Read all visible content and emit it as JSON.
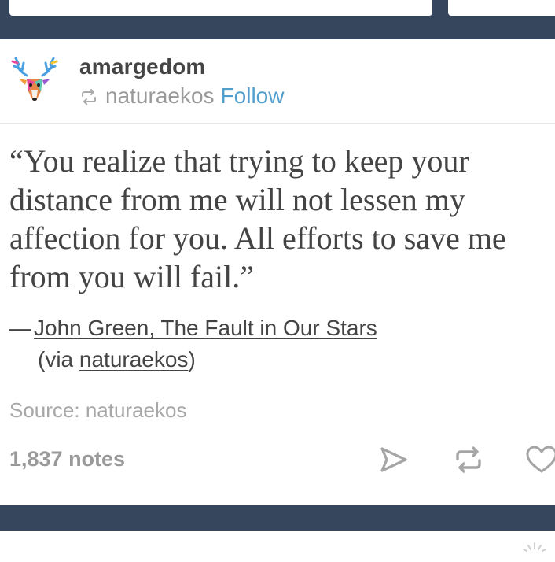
{
  "post": {
    "username": "amargedom",
    "reblogged_from": "naturaekos",
    "follow_label": "Follow",
    "quote": "“You realize that trying to keep your distance from me will not lessen my affection for you. All efforts to save me from you will fail.”",
    "attribution": {
      "dash": "—",
      "author_link": "John Green, The Fault in Our Stars",
      "via_prefix": "(via ",
      "via_link": "naturaekos",
      "via_suffix": ")"
    },
    "source_label": "Source: naturaekos",
    "notes_label": "1,837 notes"
  },
  "icons": {
    "reblog_small": "reblog-icon",
    "share": "share-icon",
    "reblog": "reblog-icon",
    "like": "heart-icon",
    "avatar": "deer-avatar"
  },
  "colors": {
    "dashboard_bg": "#36465d",
    "follow_link": "#529ecc",
    "text": "#444444",
    "muted": "#999999"
  }
}
